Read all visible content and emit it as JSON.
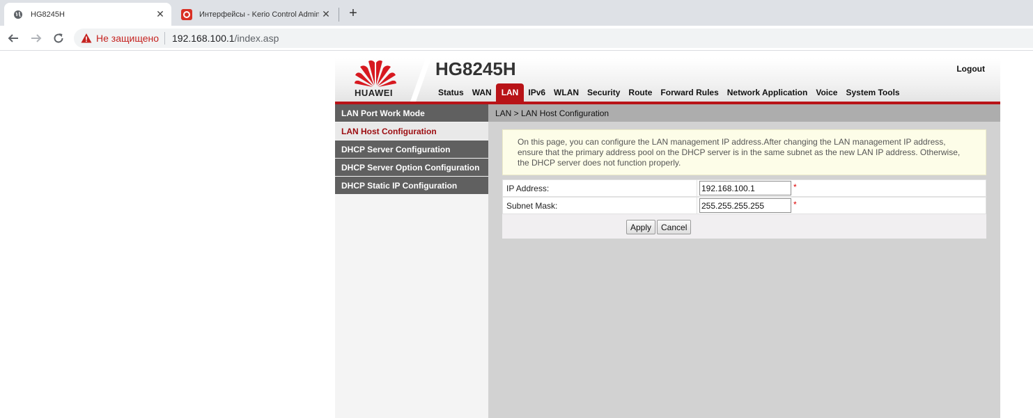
{
  "browser": {
    "tabs": [
      {
        "title": "HG8245H",
        "active": true,
        "icon": "globe-icon"
      },
      {
        "title": "Интерфейсы - Kerio Control Adminis",
        "active": false,
        "icon": "kerio-icon"
      }
    ],
    "security_label": "Не защищено",
    "url_host": "192.168.100.1",
    "url_path": "/index.asp"
  },
  "header": {
    "brand": "HUAWEI",
    "model": "HG8245H",
    "logout": "Logout",
    "accent_color": "#b81317"
  },
  "menu": [
    {
      "label": "Status",
      "active": false
    },
    {
      "label": "WAN",
      "active": false
    },
    {
      "label": "LAN",
      "active": true
    },
    {
      "label": "IPv6",
      "active": false
    },
    {
      "label": "WLAN",
      "active": false
    },
    {
      "label": "Security",
      "active": false
    },
    {
      "label": "Route",
      "active": false
    },
    {
      "label": "Forward Rules",
      "active": false
    },
    {
      "label": "Network Application",
      "active": false
    },
    {
      "label": "Voice",
      "active": false
    },
    {
      "label": "System Tools",
      "active": false
    }
  ],
  "sidebar": {
    "items": [
      {
        "label": "LAN Port Work Mode",
        "active": false
      },
      {
        "label": "LAN Host Configuration",
        "active": true
      },
      {
        "label": "DHCP Server Configuration",
        "active": false
      },
      {
        "label": "DHCP Server Option Configuration",
        "active": false
      },
      {
        "label": "DHCP Static IP Configuration",
        "active": false
      }
    ]
  },
  "breadcrumb": "LAN > LAN Host Configuration",
  "notice": "On this page, you can configure the LAN management IP address.After changing the LAN management IP address, ensure that the primary address pool on the DHCP server is in the same subnet as the new LAN IP address. Otherwise, the DHCP server does not function properly.",
  "form": {
    "ip_label": "IP Address:",
    "ip_value": "192.168.100.1",
    "mask_label": "Subnet Mask:",
    "mask_value": "255.255.255.255",
    "required_mark": "*",
    "apply_label": "Apply",
    "cancel_label": "Cancel"
  }
}
